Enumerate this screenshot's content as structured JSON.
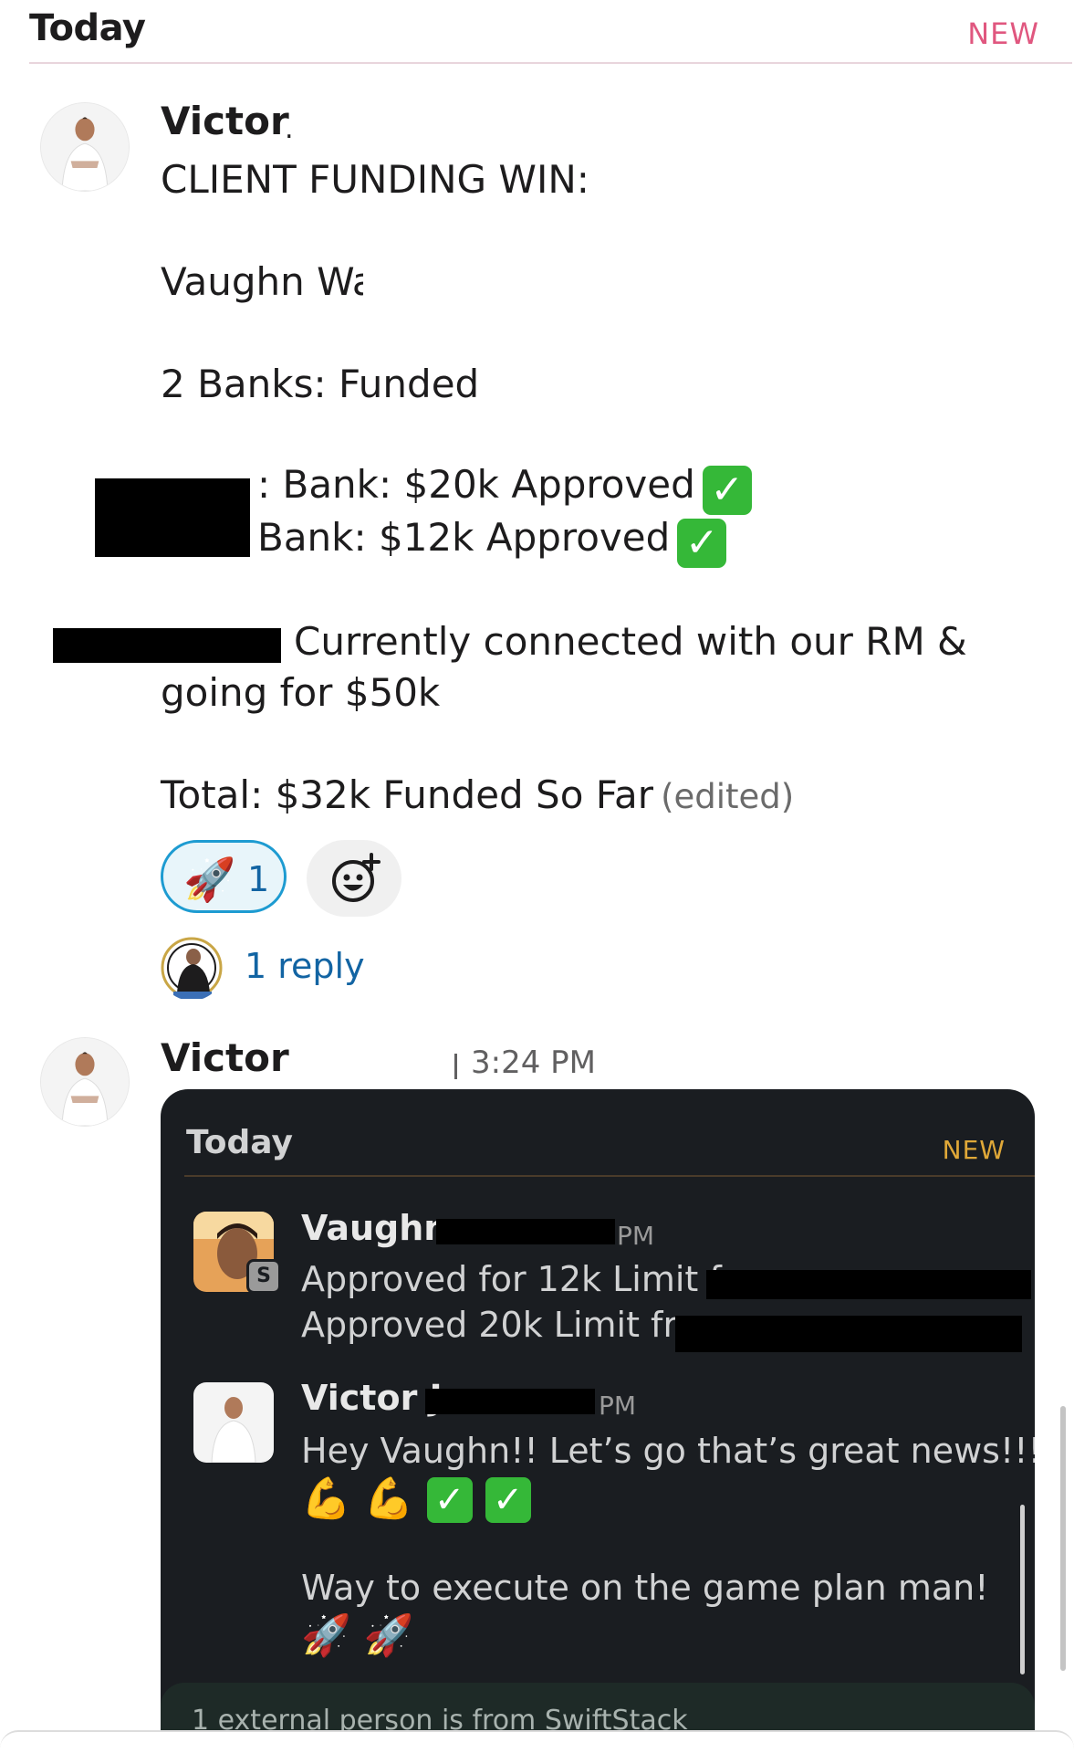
{
  "day_divider": {
    "label": "Today",
    "new_label": "NEW"
  },
  "message1": {
    "author": "Victor",
    "author_suffix": ".",
    "lines": {
      "title": "CLIENT FUNDING WIN:",
      "client": "Vaughn Wa",
      "banks": "2 Banks: Funded",
      "bank1": ": Bank: $20k Approved",
      "bank2": "Bank: $12k Approved",
      "rm1": "Currently connected with our RM &",
      "rm2": "going for $50k",
      "total": "Total: $32k Funded So Far"
    },
    "edited": "(edited)",
    "check_icon": "✓",
    "reaction": {
      "emoji": "🚀",
      "count": "1"
    },
    "reply_link": "1 reply"
  },
  "message2": {
    "author": "Victor",
    "timestamp": "3:24 PM",
    "embed": {
      "day_label": "Today",
      "new_label": "NEW",
      "msg_a": {
        "author": "Vaughn",
        "time": "PM",
        "badge": "S",
        "line1": "Approved for 12k Limit from",
        "line2": "Approved 20k Limit from"
      },
      "msg_b": {
        "author": "Victor J",
        "time": "PM",
        "line1": "Hey Vaughn!! Let’s go that’s great news!!!",
        "emojis": [
          "💪",
          "💪"
        ],
        "checks": [
          "✓",
          "✓"
        ],
        "line2": "Way to execute on the game plan man!",
        "rockets": [
          "🚀",
          "🚀"
        ]
      },
      "banner": "1 external person is from SwiftStack"
    }
  },
  "colors": {
    "accent_pink": "#e0577f",
    "link_blue": "#1264a3",
    "reaction_border": "#1d9bd1",
    "check_green": "#35b838",
    "embed_bg": "#1a1d21"
  }
}
